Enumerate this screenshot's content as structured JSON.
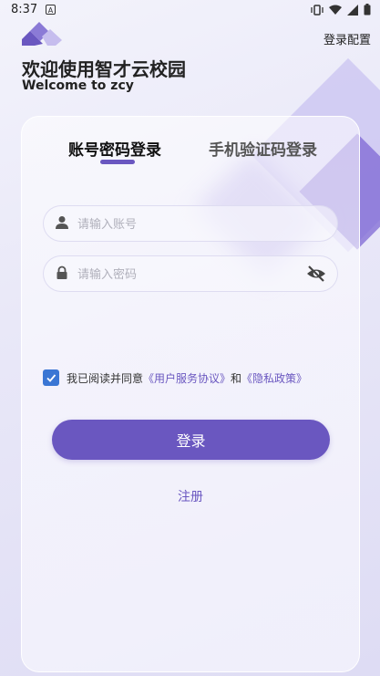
{
  "status_bar": {
    "time": "8:37",
    "notification_letter": "A"
  },
  "header": {
    "settings_label": "登录配置",
    "title_cn": "欢迎使用智才云校园",
    "title_en": "Welcome to zcy"
  },
  "tabs": [
    {
      "label": "账号密码登录",
      "active": true
    },
    {
      "label": "手机验证码登录",
      "active": false
    }
  ],
  "form": {
    "account_placeholder": "请输入账号",
    "account_value": "",
    "password_placeholder": "请输入密码",
    "password_value": ""
  },
  "agreement": {
    "checked": true,
    "prefix": "我已阅读并同意",
    "user_agreement": "《用户服务协议》",
    "conjunction": "和",
    "privacy_policy": "《隐私政策》"
  },
  "login_label": "登录",
  "register_label": "注册",
  "colors": {
    "accent": "#6a57c0",
    "checkbox": "#3a76d4"
  }
}
